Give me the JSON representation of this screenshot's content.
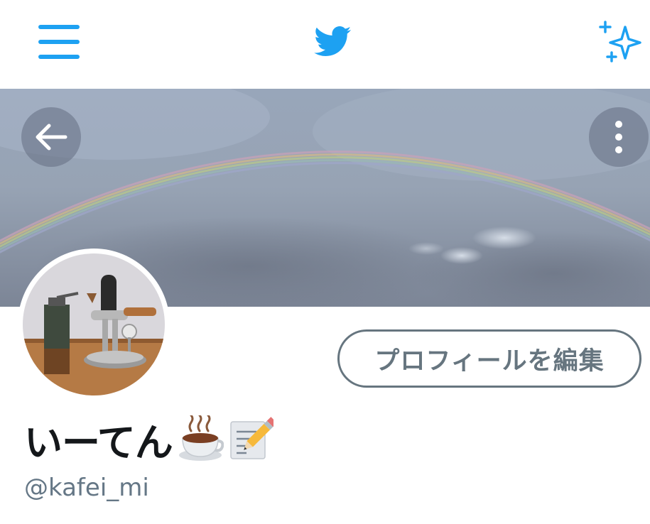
{
  "header": {
    "menu_icon": "hamburger-menu-icon",
    "logo_icon": "twitter-bird-icon",
    "sparkle_icon": "sparkle-icon",
    "accent_color": "#1DA1F2"
  },
  "banner": {
    "image": "rainbow-over-cloudy-sky",
    "back_icon": "arrow-left-icon",
    "more_icon": "more-vertical-icon"
  },
  "profile": {
    "avatar_image": "coffee-grinder-and-espresso-maker",
    "edit_button_label": "プロフィールを編集",
    "display_name": "いーてん",
    "name_emojis": [
      "hot-beverage-icon",
      "memo-icon"
    ],
    "handle": "@kafei_mi"
  }
}
